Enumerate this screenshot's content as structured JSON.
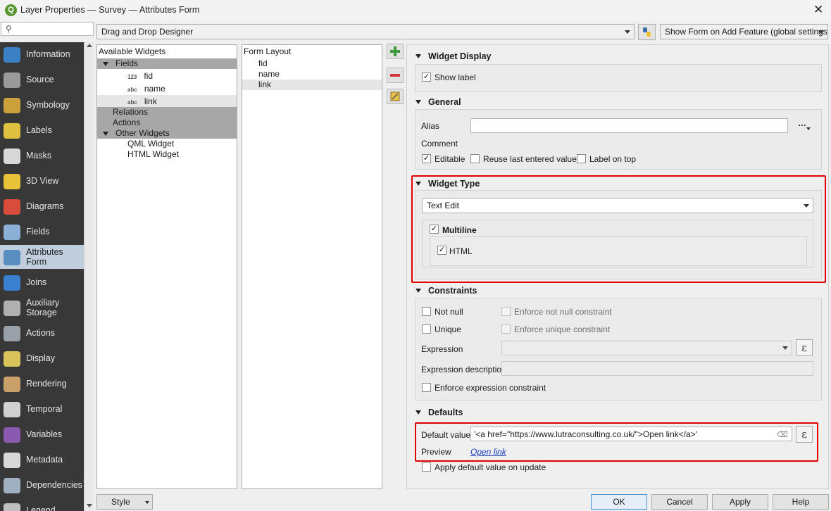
{
  "window": {
    "title": "Layer Properties — Survey — Attributes Form",
    "logo": "Q",
    "close": "✕"
  },
  "nav": {
    "items": [
      {
        "label": "Information",
        "icon": "information-icon",
        "color": "#3b7fc4"
      },
      {
        "label": "Source",
        "icon": "source-icon",
        "color": "#9a9a9a"
      },
      {
        "label": "Symbology",
        "icon": "symbology-icon",
        "color": "#c9a03a"
      },
      {
        "label": "Labels",
        "icon": "labels-icon",
        "color": "#e0c040"
      },
      {
        "label": "Masks",
        "icon": "masks-icon",
        "color": "#d8d8d8"
      },
      {
        "label": "3D View",
        "icon": "3d-view-icon",
        "color": "#e8c33a"
      },
      {
        "label": "Diagrams",
        "icon": "diagrams-icon",
        "color": "#d94b3a"
      },
      {
        "label": "Fields",
        "icon": "fields-icon",
        "color": "#8ab0d6"
      },
      {
        "label": "Attributes\nForm",
        "icon": "attributes-form-icon",
        "color": "#5a8ec0"
      },
      {
        "label": "Joins",
        "icon": "joins-icon",
        "color": "#3a7fd0"
      },
      {
        "label": "Auxiliary\nStorage",
        "icon": "auxiliary-storage-icon",
        "color": "#b0b0b0"
      },
      {
        "label": "Actions",
        "icon": "actions-icon",
        "color": "#9aa0a8"
      },
      {
        "label": "Display",
        "icon": "display-icon",
        "color": "#d9c35a"
      },
      {
        "label": "Rendering",
        "icon": "rendering-icon",
        "color": "#c9a06a"
      },
      {
        "label": "Temporal",
        "icon": "temporal-icon",
        "color": "#d0d0d0"
      },
      {
        "label": "Variables",
        "icon": "variables-icon",
        "color": "#8a5ab0"
      },
      {
        "label": "Metadata",
        "icon": "metadata-icon",
        "color": "#d8d8d8"
      },
      {
        "label": "Dependencies",
        "icon": "dependencies-icon",
        "color": "#a0b0c0"
      },
      {
        "label": "Legend",
        "icon": "legend-icon",
        "color": "#c0c0c0"
      }
    ]
  },
  "toolbar": {
    "designer": "Drag and Drop Designer",
    "python_icon": "python-icon",
    "show_form": "Show Form on Add Feature (global settings)"
  },
  "available": {
    "header": "Available Widgets",
    "fields_label": "Fields",
    "fields": [
      {
        "type": "123",
        "name": "fid"
      },
      {
        "type": "abc",
        "name": "name"
      },
      {
        "type": "abc",
        "name": "link"
      }
    ],
    "relations": "Relations",
    "actions": "Actions",
    "other": "Other Widgets",
    "other_items": [
      "QML Widget",
      "HTML Widget"
    ]
  },
  "layout": {
    "header": "Form Layout",
    "items": [
      "fid",
      "name",
      "link"
    ]
  },
  "side_buttons": {
    "add": "+",
    "remove": "−"
  },
  "widget_display": {
    "title": "Widget Display",
    "show_label": "Show label"
  },
  "general": {
    "title": "General",
    "alias_label": "Alias",
    "alias_value": "",
    "alias_more": "…",
    "comment_label": "Comment",
    "editable": "Editable",
    "reuse": "Reuse last entered value",
    "label_on_top": "Label on top"
  },
  "widget_type": {
    "title": "Widget Type",
    "value": "Text Edit",
    "multiline": "Multiline",
    "html": "HTML"
  },
  "constraints": {
    "title": "Constraints",
    "not_null": "Not null",
    "enforce_not_null": "Enforce not null constraint",
    "unique": "Unique",
    "enforce_unique": "Enforce unique constraint",
    "expression": "Expression",
    "expression_description": "Expression description",
    "enforce_expression": "Enforce expression constraint",
    "epsilon": "ε"
  },
  "defaults": {
    "title": "Defaults",
    "default_value_label": "Default value",
    "default_value": "'<a href=\"https://www.lutraconsulting.co.uk/\">Open link</a>'",
    "preview_label": "Preview",
    "preview_link": "Open link",
    "apply_on_update": "Apply default value on update",
    "clear_icon": "⌫",
    "epsilon": "ε"
  },
  "bottom": {
    "style": "Style",
    "ok": "OK",
    "cancel": "Cancel",
    "apply": "Apply",
    "help": "Help"
  },
  "colors": {
    "highlight": "#e00000",
    "nav_bg": "#383838",
    "nav_active": "#bfcddc",
    "link": "#1a3fc0"
  }
}
